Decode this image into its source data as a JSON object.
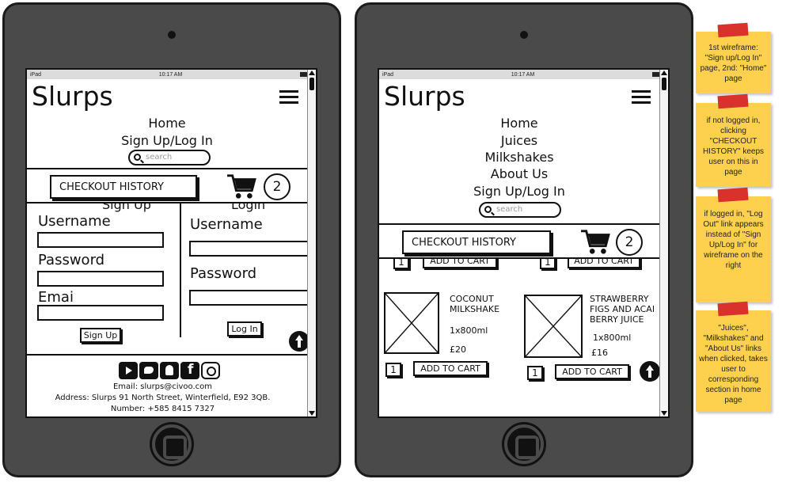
{
  "statusbar": {
    "device": "iPad",
    "time": "10:17 AM"
  },
  "brand": "Slurps",
  "left": {
    "nav": [
      "Home",
      "Sign Up/Log In"
    ],
    "search_placeholder": "search",
    "checkout_label": "CHECKOUT HISTORY",
    "cart_count": "2",
    "signup": {
      "heading": "Sign Up",
      "username_label": "Username",
      "password_label": "Password",
      "email_label": "Emai",
      "button": "Sign Up"
    },
    "login": {
      "heading": "Login",
      "username_label": "Username",
      "password_label": "Password",
      "button": "Log In"
    },
    "footer": {
      "social_icons": [
        "youtube-icon",
        "twitter-icon",
        "snapchat-icon",
        "facebook-icon",
        "instagram-icon"
      ],
      "email": "Email: slurps@civoo.com",
      "address": "Address: Slurps 91 North Street, Winterfield, E92 3QB.",
      "number": "Number: +585 8415 7327"
    }
  },
  "right": {
    "nav": [
      "Home",
      "Juices",
      "Milkshakes",
      "About Us",
      "Sign Up/Log In"
    ],
    "search_placeholder": "search",
    "checkout_label": "CHECKOUT HISTORY",
    "cart_count": "2",
    "partial_row": {
      "qty": "1",
      "add_label": "ADD TO CART"
    },
    "products": [
      {
        "name": "COCONUT MILKSHAKE",
        "size": "1x800ml",
        "price": "£20",
        "qty": "1",
        "add_label": "ADD TO CART"
      },
      {
        "name": "STRAWBERRY FIGS AND ACAI BERRY JUICE",
        "size": "1x800ml",
        "price": "£16",
        "qty": "1",
        "add_label": "ADD TO CART"
      }
    ]
  },
  "notes": [
    "1st wireframe: \"Sign up/Log In\" page, 2nd: \"Home\" page",
    "if not logged in, clicking \"CHECKOUT HISTORY\" keeps user on this in page",
    "if logged in, \"Log Out\" link appears instead of \"Sign Up/Log In\" for wireframe on the right",
    "\"Juices\", \"Milkshakes\" and \"About Us\" links when clicked, takes user to corresponding section in home page"
  ]
}
